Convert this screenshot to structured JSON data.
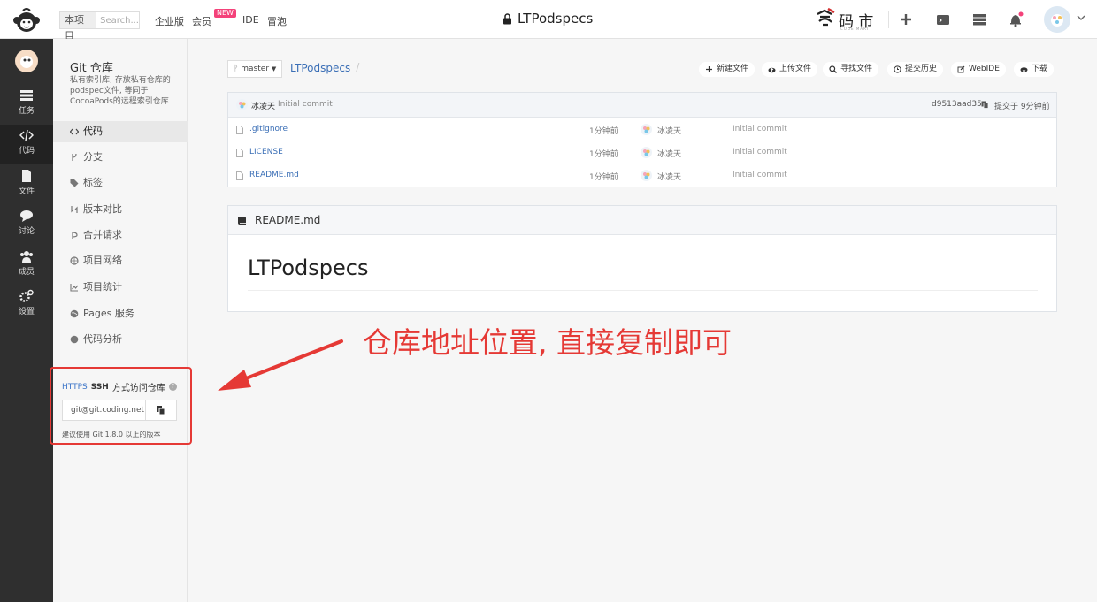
{
  "topbar": {
    "project_label": "本项目",
    "search_placeholder": "Search...",
    "nav": [
      "企业版",
      "会员",
      "IDE",
      "冒泡"
    ],
    "new_badge": "NEW",
    "title": "LTPodspecs",
    "brand": "码 市",
    "brand_sub": "CODE MART"
  },
  "rail": {
    "items": [
      {
        "label": "任务",
        "icon": "tasks-icon"
      },
      {
        "label": "代码",
        "icon": "code-icon"
      },
      {
        "label": "文件",
        "icon": "file-icon"
      },
      {
        "label": "讨论",
        "icon": "chat-icon"
      },
      {
        "label": "成员",
        "icon": "members-icon"
      },
      {
        "label": "设置",
        "icon": "settings-icon"
      }
    ]
  },
  "sidenav": {
    "title": "Git 仓库",
    "description": "私有索引库, 存放私有仓库的podspec文件, 等同于CocoaPods的远程索引仓库",
    "items": [
      {
        "label": "代码",
        "icon": "code-icon"
      },
      {
        "label": "分支",
        "icon": "branch-icon"
      },
      {
        "label": "标签",
        "icon": "tag-icon"
      },
      {
        "label": "版本对比",
        "icon": "compare-icon"
      },
      {
        "label": "合并请求",
        "icon": "merge-request-icon"
      },
      {
        "label": "项目网络",
        "icon": "network-icon"
      },
      {
        "label": "项目统计",
        "icon": "stats-icon"
      },
      {
        "label": "Pages 服务",
        "icon": "pages-icon"
      },
      {
        "label": "代码分析",
        "icon": "analysis-icon"
      }
    ]
  },
  "clone": {
    "https_label": "HTTPS",
    "ssh_label": "SSH",
    "title": "方式访问仓库",
    "url": "git@git.coding.net",
    "note": "建议使用 Git 1.8.0 以上的版本"
  },
  "repo": {
    "branch": "master",
    "name": "LTPodspecs",
    "actions": [
      {
        "label": "新建文件",
        "icon": "plus-icon"
      },
      {
        "label": "上传文件",
        "icon": "cloud-upload-icon"
      },
      {
        "label": "寻找文件",
        "icon": "search-icon"
      },
      {
        "label": "提交历史",
        "icon": "history-icon"
      },
      {
        "label": "WebIDE",
        "icon": "edit-icon"
      },
      {
        "label": "下载",
        "icon": "cloud-download-icon"
      }
    ]
  },
  "last_commit": {
    "author": "冰凌天",
    "message": "Initial commit",
    "hash": "d9513aad35",
    "time": "提交于 9分钟前"
  },
  "files": [
    {
      "name": ".gitignore",
      "ago": "1分钟前",
      "author": "冰凌天",
      "message": "Initial commit"
    },
    {
      "name": "LICENSE",
      "ago": "1分钟前",
      "author": "冰凌天",
      "message": "Initial commit"
    },
    {
      "name": "README.md",
      "ago": "1分钟前",
      "author": "冰凌天",
      "message": "Initial commit"
    }
  ],
  "readme": {
    "filename": "README.md",
    "heading": "LTPodspecs"
  },
  "annotation": {
    "text": "仓库地址位置, 直接复制即可",
    "color": "#e53935"
  }
}
